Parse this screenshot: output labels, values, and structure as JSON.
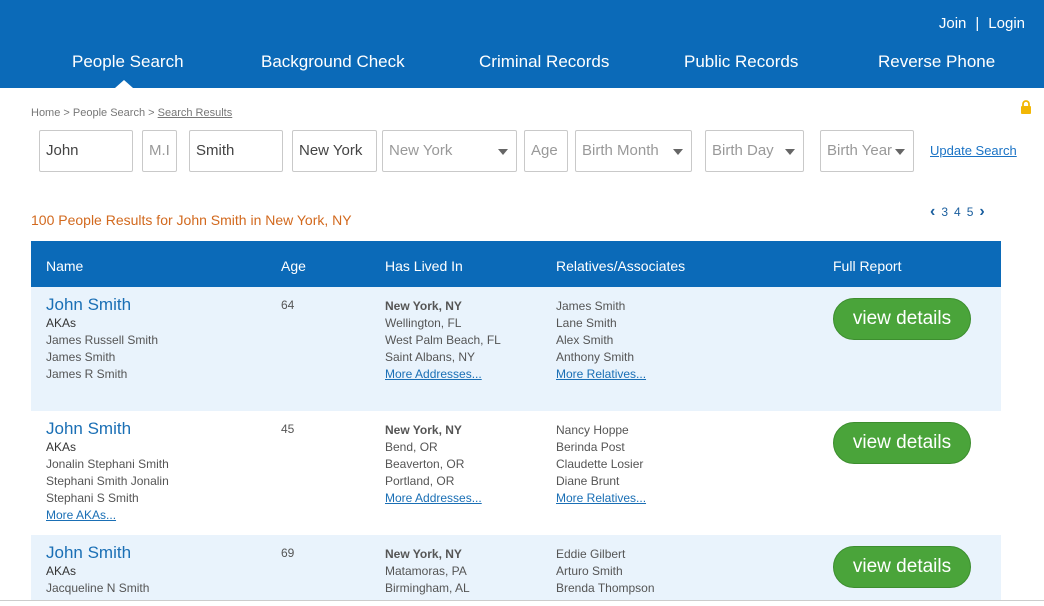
{
  "auth": {
    "join": "Join",
    "separator": "|",
    "login": "Login"
  },
  "nav": [
    "People Search",
    "Background Check",
    "Criminal Records",
    "Public Records",
    "Reverse Phone"
  ],
  "breadcrumb": {
    "home": "Home",
    "sep": ">",
    "people_search": "People Search",
    "current": "Search Results"
  },
  "search": {
    "first": "John",
    "middle_placeholder": "M.I",
    "last": "Smith",
    "city": "New York",
    "state": "New York",
    "age_placeholder": "Age",
    "birth_month": "Birth Month",
    "birth_day": "Birth Day",
    "birth_year": "Birth Year",
    "update": "Update Search"
  },
  "results_title": "100 People Results for John Smith in New York, NY",
  "pager": {
    "pages": [
      "3",
      "4",
      "5"
    ]
  },
  "table": {
    "headers": {
      "name": "Name",
      "age": "Age",
      "lived": "Has Lived In",
      "relatives": "Relatives/Associates",
      "report": "Full Report"
    },
    "aka_label": "AKAs",
    "more_addresses": "More Addresses...",
    "more_relatives": "More Relatives...",
    "more_akas": "More AKAs...",
    "button": "view details",
    "rows": [
      {
        "name": "John Smith",
        "age": "64",
        "akas": [
          "James Russell Smith",
          "James Smith",
          "James R Smith"
        ],
        "lived": [
          "New York, NY",
          "Wellington, FL",
          "West Palm Beach, FL",
          "Saint Albans, NY"
        ],
        "relatives": [
          "James Smith",
          "Lane Smith",
          "Alex Smith",
          "Anthony Smith"
        ]
      },
      {
        "name": "John Smith",
        "age": "45",
        "akas": [
          "Jonalin Stephani Smith",
          "Stephani Smith Jonalin",
          "Stephani S Smith"
        ],
        "lived": [
          "New York, NY",
          "Bend, OR",
          "Beaverton, OR",
          "Portland, OR"
        ],
        "relatives": [
          "Nancy Hoppe",
          "Berinda Post",
          "Claudette Losier",
          "Diane Brunt"
        ]
      },
      {
        "name": "John Smith",
        "age": "69",
        "akas": [
          "Jacqueline N Smith"
        ],
        "lived": [
          "New York, NY",
          "Matamoras, PA",
          "Birmingham, AL"
        ],
        "relatives": [
          "Eddie Gilbert",
          "Arturo Smith",
          "Brenda Thompson"
        ]
      }
    ]
  },
  "colors": {
    "primary": "#0b6ab8",
    "accent": "#d2691e",
    "button": "#4aa43a",
    "row_alt": "#e9f3fc"
  }
}
